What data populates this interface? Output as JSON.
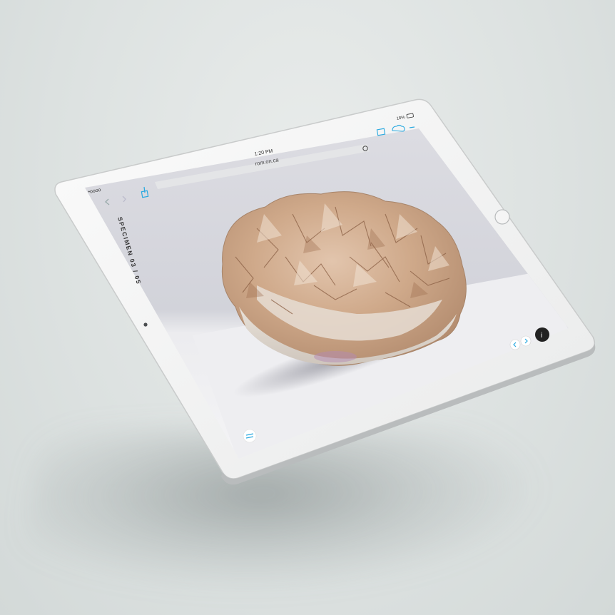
{
  "status_bar": {
    "carrier": "•oooo",
    "time": "1:20 PM",
    "battery": "18%"
  },
  "browser": {
    "url": "rom.on.ca",
    "back_icon": "chevron-left-icon",
    "forward_icon": "chevron-right-icon",
    "share_icon": "share-icon",
    "reload_icon": "reload-icon",
    "bookmarks_icon": "book-icon",
    "cloud_icon": "cloud-icon",
    "new_tab_icon": "plus-icon"
  },
  "page": {
    "specimen_label": "SPECIMEN 03 / 05",
    "menu_icon": "menu-icon",
    "prev_icon": "chevron-left-icon",
    "next_icon": "chevron-right-icon",
    "info_icon": "info-icon",
    "info_label": "i"
  },
  "colors": {
    "accent": "#29a9e0",
    "device_frame": "#f4f5f5",
    "info_button": "#222222"
  }
}
